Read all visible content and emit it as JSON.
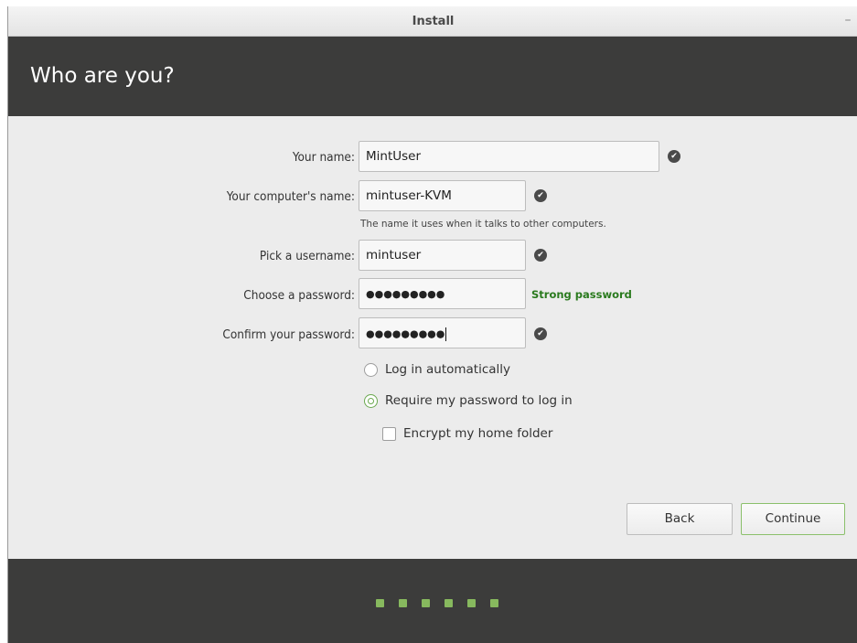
{
  "window": {
    "title": "Install",
    "minimize_label": "–"
  },
  "header": {
    "heading": "Who are you?"
  },
  "form": {
    "name_label": "Your name:",
    "name_value": "MintUser",
    "computer_label": "Your computer's name:",
    "computer_value": "mintuser-KVM",
    "computer_hint": "The name it uses when it talks to other computers.",
    "username_label": "Pick a username:",
    "username_value": "mintuser",
    "password_label": "Choose a password:",
    "password_value": "●●●●●●●●●",
    "password_strength": "Strong password",
    "confirm_label": "Confirm your password:",
    "confirm_value": "●●●●●●●●●",
    "check_icon": "check-circle-icon",
    "check_glyph": "✔"
  },
  "login_options": {
    "auto_login_label": "Log in automatically",
    "auto_login_selected": false,
    "require_password_label": "Require my password to log in",
    "require_password_selected": true,
    "encrypt_home_label": "Encrypt my home folder",
    "encrypt_home_checked": false
  },
  "buttons": {
    "back_label": "Back",
    "continue_label": "Continue"
  },
  "progress": {
    "dot_count": 6
  },
  "colors": {
    "header_bg": "#3c3c3b",
    "accent_green": "#87b95e",
    "strength_text": "#2a7a1e"
  }
}
